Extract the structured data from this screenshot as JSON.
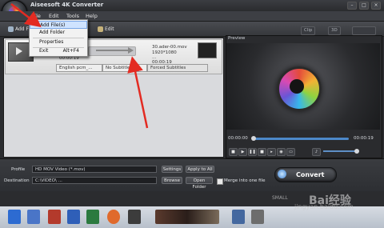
{
  "window": {
    "title": "Aiseesoft 4K Converter"
  },
  "menubar": {
    "items": [
      "File",
      "Edit",
      "Tools",
      "Help"
    ]
  },
  "file_menu": {
    "items": [
      {
        "label": "Add File(s)",
        "shortcut": ""
      },
      {
        "label": "Add Folder",
        "shortcut": ""
      },
      {
        "label": "Properties",
        "shortcut": ""
      },
      {
        "label": "Exit",
        "shortcut": "Alt+F4"
      }
    ]
  },
  "toolbar": {
    "add_file": "Add File",
    "edit": "Edit",
    "right_btn1": "Clip",
    "right_btn2": "3D"
  },
  "file_item": {
    "source_name": "...",
    "source_size": "...",
    "source_time": "00:00:19",
    "output_name": "30.ader-00.mov",
    "output_res": "1920*1080",
    "output_size": "...",
    "output_time": "00:00:19",
    "audio": "English pcm_...",
    "subtitle": "No Subtitle",
    "forced_subtitle": "Forced Subtitles"
  },
  "preview": {
    "label": "Preview",
    "time_start": "00:00:00",
    "time_end": "00:00:19"
  },
  "bottom": {
    "profile_label": "Profile",
    "profile_value": "HD MOV Video (*.mov)",
    "settings": "Settings",
    "apply_all": "Apply to All",
    "destination_label": "Destination",
    "destination_value": "C:\\VIDEO\\ ...",
    "browse": "Browse",
    "open_folder": "Open Folder",
    "merge_label": "Merge into one file",
    "convert": "Convert"
  },
  "watermark": {
    "main": "Bai经验",
    "sub": "jingyan.baidu.com",
    "left": "SMALL"
  },
  "colors": {
    "dropdown_highlight": "#cfe3ff",
    "accent_blue": "#4c88c9",
    "annotation_red": "#e32b22"
  }
}
